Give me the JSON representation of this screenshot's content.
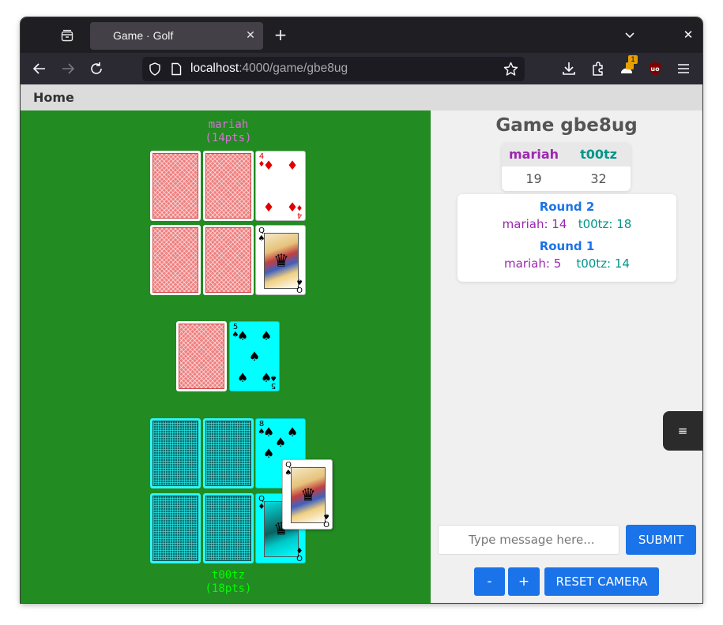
{
  "browser": {
    "tab_title": "Game · Golf",
    "url_host": "localhost",
    "url_path": ":4000/game/gbe8ug",
    "ext_badge": "1"
  },
  "nav": {
    "home": "Home"
  },
  "table": {
    "top_player": {
      "name": "mariah",
      "points": "(14pts)",
      "color": "#da70d6"
    },
    "bottom_player": {
      "name": "t00tz",
      "points": "(18pts)",
      "color": "#00ff00"
    },
    "top_cards": [
      {
        "face": "back"
      },
      {
        "face": "back"
      },
      {
        "rank": "4",
        "suit": "♦",
        "color": "red"
      },
      {
        "face": "back"
      },
      {
        "face": "back"
      },
      {
        "rank": "Q",
        "suit": "♠",
        "color": "black"
      }
    ],
    "deck": {
      "face": "back"
    },
    "discard": {
      "rank": "5",
      "suit": "♠",
      "color": "black"
    },
    "bottom_cards": [
      {
        "face": "back"
      },
      {
        "face": "back"
      },
      {
        "rank": "8",
        "suit": "♠",
        "color": "black"
      },
      {
        "face": "back"
      },
      {
        "face": "back"
      },
      {
        "rank": "Q",
        "suit": "♦",
        "color": "black"
      }
    ],
    "held_card": {
      "rank": "Q",
      "suit": "♠",
      "color": "black"
    }
  },
  "side": {
    "game_title": "Game gbe8ug",
    "scores": {
      "headers": [
        "mariah",
        "t00tz"
      ],
      "totals": [
        "19",
        "32"
      ]
    },
    "rounds": [
      {
        "title": "Round 2",
        "p1": "mariah: 14",
        "p2": "t00tz: 18"
      },
      {
        "title": "Round 1",
        "p1": "mariah: 5",
        "p2": "t00tz: 14"
      }
    ],
    "message_placeholder": "Type message here...",
    "submit": "SUBMIT",
    "zoom_out": "-",
    "zoom_in": "+",
    "reset_camera": "RESET CAMERA"
  },
  "colors": {
    "table_green": "#228b22",
    "accent_blue": "#1a73e8",
    "player1": "#9c27b0",
    "player2": "#009688"
  }
}
